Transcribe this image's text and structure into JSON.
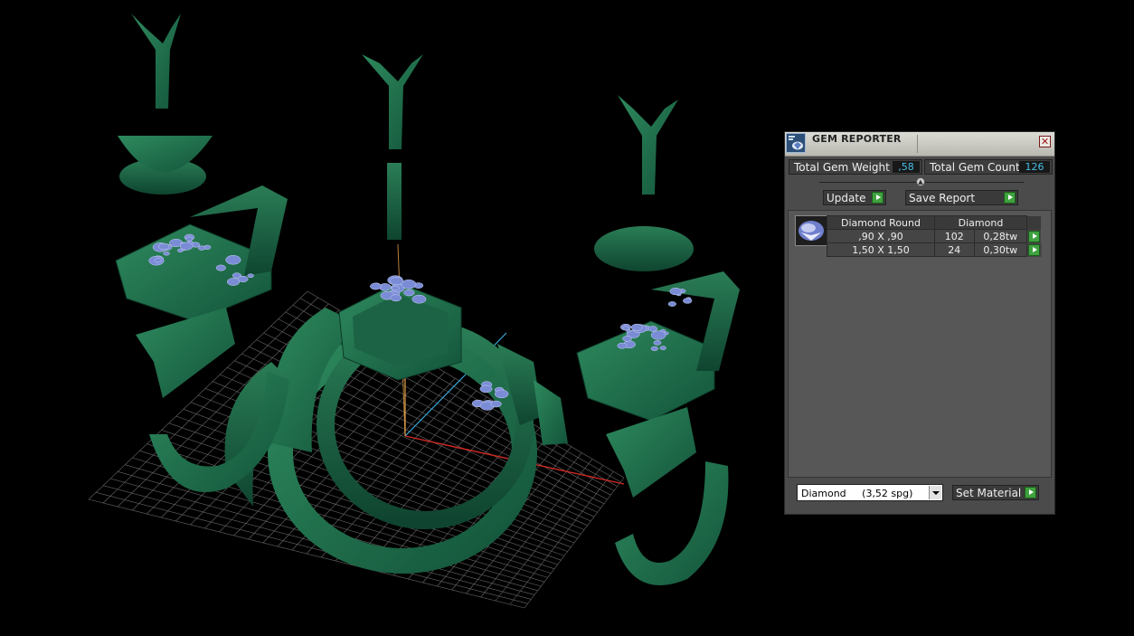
{
  "panel": {
    "title": "GEM REPORTER",
    "close_glyph": "✕",
    "total_gem_weight_label": "Total Gem Weight",
    "total_gem_weight": ",58",
    "total_gem_count_label": "Total Gem Count",
    "total_gem_count": "126",
    "update_label": "Update",
    "save_report_label": "Save Report",
    "table": {
      "gem_type": "Diamond Round",
      "material": "Diamond",
      "rows": [
        {
          "size": ",90 X ,90",
          "count": "102",
          "weight": "0,28tw"
        },
        {
          "size": "1,50 X 1,50",
          "count": "24",
          "weight": "0,30tw"
        }
      ]
    },
    "material_select": "Diamond     (3,52 spg)",
    "set_material_label": "Set Material"
  },
  "icons": {
    "title": "gem-reporter-icon",
    "close": "close-icon",
    "run": "green-arrow-icon",
    "gem": "diamond-gem-icon"
  },
  "colors": {
    "model": "#1f6b4a",
    "gems": "#7b8cd6",
    "value_text": "#46bfe8",
    "go_button": "#3fa23f"
  }
}
